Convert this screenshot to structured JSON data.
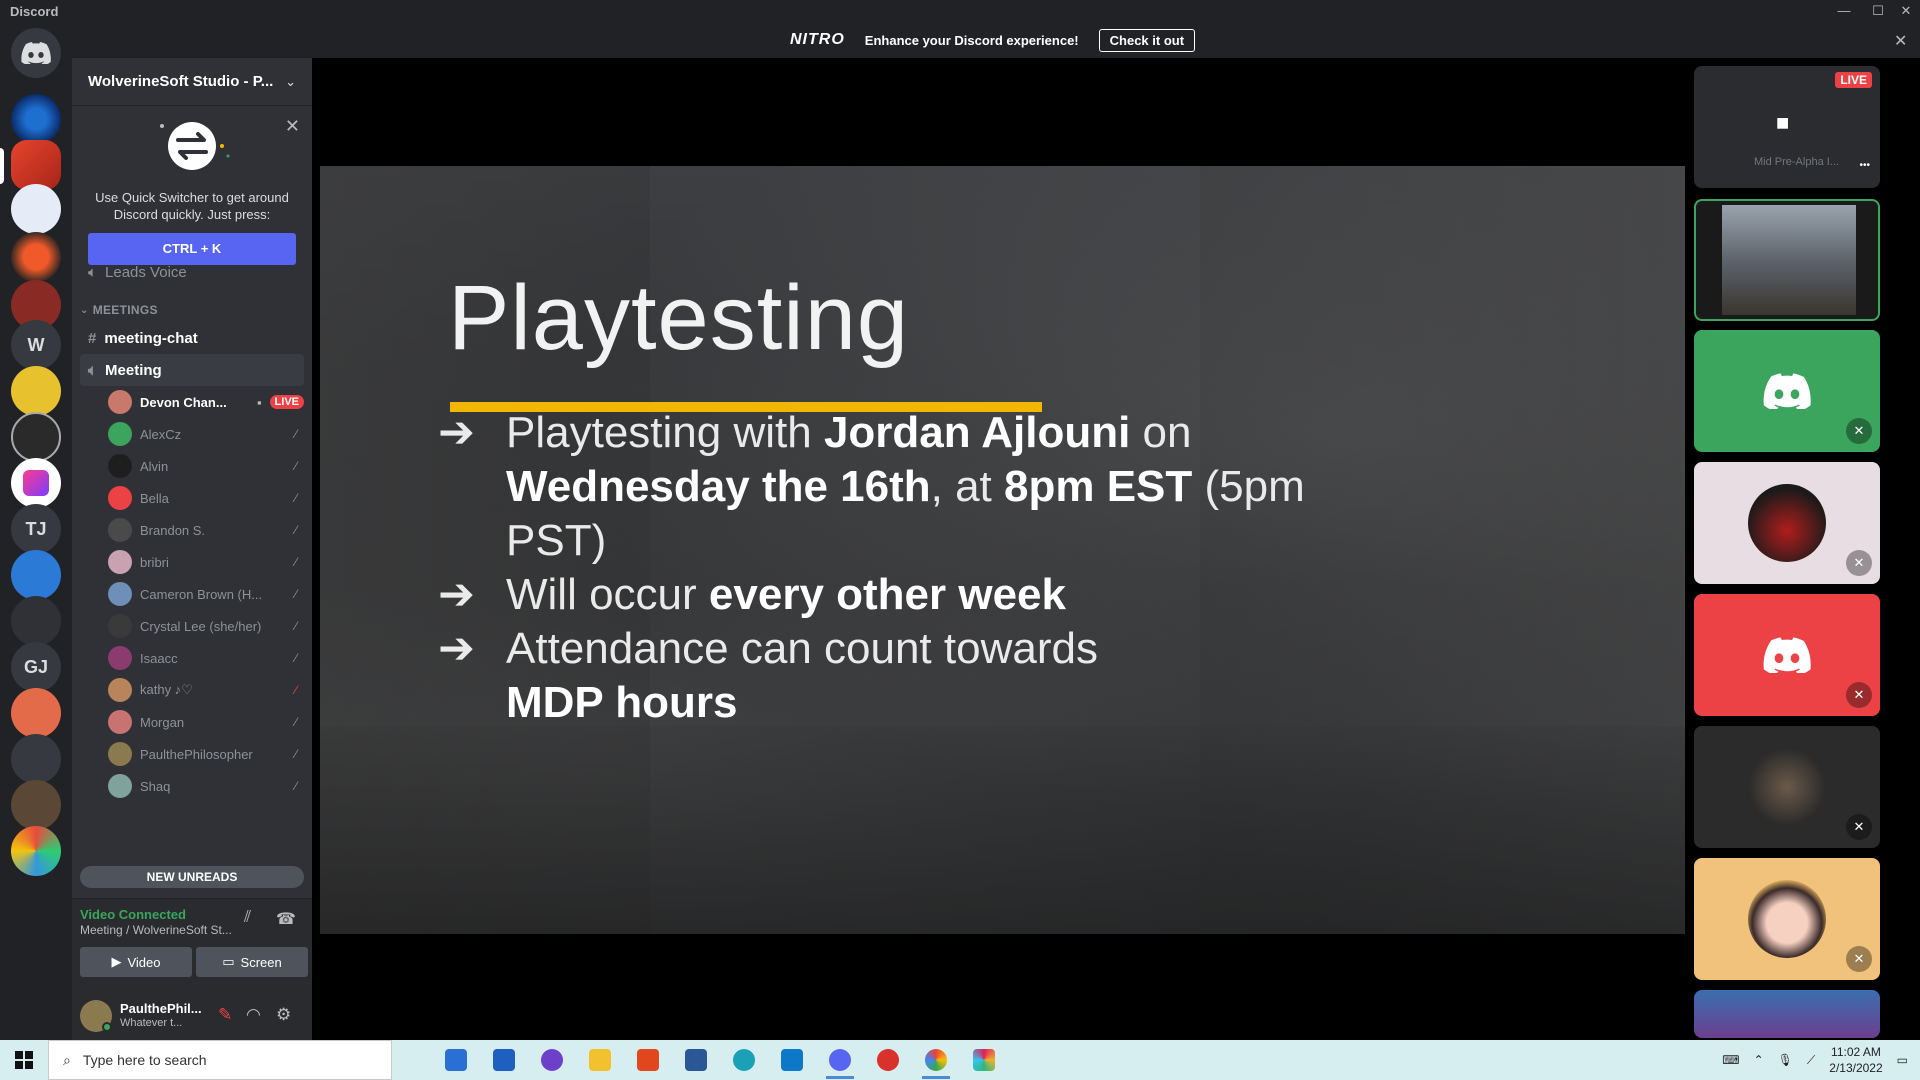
{
  "window": {
    "app_name": "Discord",
    "controls": {
      "minimize": "—",
      "maximize": "☐",
      "close": "✕"
    }
  },
  "nitro_banner": {
    "logo": "NITRO",
    "message": "Enhance your Discord experience!",
    "cta_label": "Check it out",
    "close": "✕"
  },
  "server_rail": {
    "items": [
      {
        "name": "home",
        "label": ""
      },
      {
        "name": "server-1",
        "label": ""
      },
      {
        "name": "server-2",
        "label": ""
      },
      {
        "name": "server-3",
        "label": ""
      },
      {
        "name": "server-4",
        "label": ""
      },
      {
        "name": "server-5",
        "label": ""
      },
      {
        "name": "server-w",
        "label": "W"
      },
      {
        "name": "server-7",
        "label": ""
      },
      {
        "name": "server-8",
        "label": ""
      },
      {
        "name": "server-9",
        "label": ""
      },
      {
        "name": "server-tj",
        "label": "TJ"
      },
      {
        "name": "server-11",
        "label": ""
      },
      {
        "name": "server-12",
        "label": ""
      },
      {
        "name": "server-gj",
        "label": "GJ"
      },
      {
        "name": "server-14",
        "label": ""
      },
      {
        "name": "server-15",
        "label": ""
      },
      {
        "name": "server-16",
        "label": ""
      },
      {
        "name": "server-17",
        "label": ""
      }
    ]
  },
  "sidebar": {
    "server_name": "WolverineSoft Studio - P...",
    "quick_switcher": {
      "text": "Use Quick Switcher to get around Discord quickly. Just press:",
      "shortcut": "CTRL + K",
      "close": "✕"
    },
    "channels_top": [
      {
        "label": "Leads Voice"
      }
    ],
    "category": "MEETINGS",
    "channels": [
      {
        "label": "meeting-chat",
        "type": "text"
      },
      {
        "label": "Meeting",
        "type": "voice"
      }
    ],
    "voice_members": [
      {
        "name": "Devon Chan...",
        "live": true,
        "live_label": "LIVE",
        "color": "#c8796b"
      },
      {
        "name": "AlexCz",
        "color": "#3ba55d"
      },
      {
        "name": "Alvin",
        "color": "#1e1e1e"
      },
      {
        "name": "Bella",
        "color": "#ed4245"
      },
      {
        "name": "Brandon S.",
        "color": "#4a4a4a"
      },
      {
        "name": "bribri",
        "color": "#caa1b0"
      },
      {
        "name": "Cameron Brown (H...",
        "color": "#6f8fb8"
      },
      {
        "name": "Crystal Lee (she/her)",
        "color": "#3a3a3a"
      },
      {
        "name": "Isaacc",
        "color": "#8c3b6f"
      },
      {
        "name": "kathy ♪♡",
        "color": "#b9845b",
        "muted_red": true
      },
      {
        "name": "Morgan",
        "color": "#c97272"
      },
      {
        "name": "PaulthePhilosopher",
        "color": "#8b7a4f"
      },
      {
        "name": "Shaq",
        "color": "#7fa39a"
      }
    ],
    "new_unreads": "NEW UNREADS"
  },
  "voice_panel": {
    "status": "Video Connected",
    "location": "Meeting / WolverineSoft St...",
    "video_label": "Video",
    "screen_label": "Screen"
  },
  "user_panel": {
    "name": "PaulthePhil...",
    "status": "Whatever t..."
  },
  "slide": {
    "title": "Playtesting",
    "arrow": "➔",
    "bullets": [
      {
        "parts": [
          "Playtesting with ",
          "Jordan Ajlouni",
          " on ",
          "Wednesday the 16th",
          ", at ",
          "8pm EST",
          " (5pm PST)"
        ]
      },
      {
        "parts": [
          "Will occur ",
          "every other week"
        ]
      },
      {
        "parts": [
          "Attendance can count towards ",
          "MDP hours"
        ]
      }
    ]
  },
  "tiles": {
    "live_badge": "LIVE",
    "stream_caption": "Mid Pre-Alpha I...",
    "more": "•••"
  },
  "taskbar": {
    "search_placeholder": "Type here to search",
    "time": "11:02 AM",
    "date": "2/13/2022"
  },
  "colors": {
    "blurple": "#5865f2",
    "green": "#3ba55d",
    "red": "#ed4245",
    "accent_yellow": "#f2b705",
    "tile_pink": "#e8dde3",
    "tile_dark": "#2b2b2b",
    "tile_peach": "#f0c27b"
  }
}
